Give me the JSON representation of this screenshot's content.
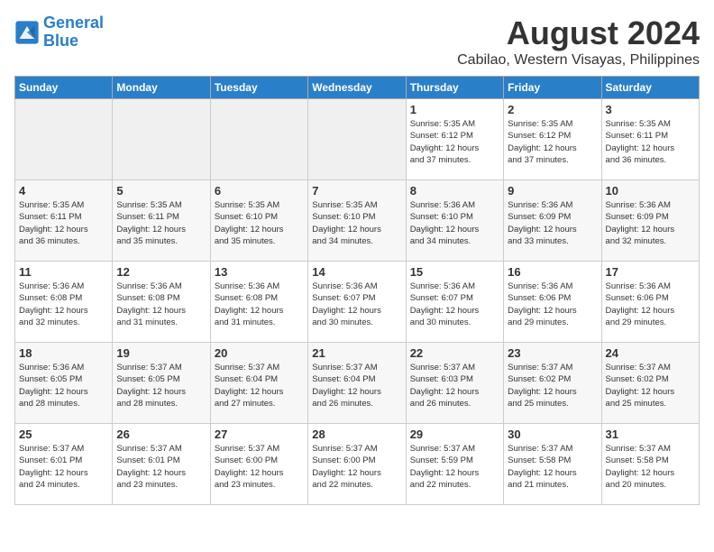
{
  "logo": {
    "line1": "General",
    "line2": "Blue"
  },
  "title": "August 2024",
  "subtitle": "Cabilao, Western Visayas, Philippines",
  "days_of_week": [
    "Sunday",
    "Monday",
    "Tuesday",
    "Wednesday",
    "Thursday",
    "Friday",
    "Saturday"
  ],
  "weeks": [
    [
      {
        "num": "",
        "info": "",
        "empty": true
      },
      {
        "num": "",
        "info": "",
        "empty": true
      },
      {
        "num": "",
        "info": "",
        "empty": true
      },
      {
        "num": "",
        "info": "",
        "empty": true
      },
      {
        "num": "1",
        "info": "Sunrise: 5:35 AM\nSunset: 6:12 PM\nDaylight: 12 hours\nand 37 minutes.",
        "empty": false
      },
      {
        "num": "2",
        "info": "Sunrise: 5:35 AM\nSunset: 6:12 PM\nDaylight: 12 hours\nand 37 minutes.",
        "empty": false
      },
      {
        "num": "3",
        "info": "Sunrise: 5:35 AM\nSunset: 6:11 PM\nDaylight: 12 hours\nand 36 minutes.",
        "empty": false
      }
    ],
    [
      {
        "num": "4",
        "info": "Sunrise: 5:35 AM\nSunset: 6:11 PM\nDaylight: 12 hours\nand 36 minutes.",
        "empty": false
      },
      {
        "num": "5",
        "info": "Sunrise: 5:35 AM\nSunset: 6:11 PM\nDaylight: 12 hours\nand 35 minutes.",
        "empty": false
      },
      {
        "num": "6",
        "info": "Sunrise: 5:35 AM\nSunset: 6:10 PM\nDaylight: 12 hours\nand 35 minutes.",
        "empty": false
      },
      {
        "num": "7",
        "info": "Sunrise: 5:35 AM\nSunset: 6:10 PM\nDaylight: 12 hours\nand 34 minutes.",
        "empty": false
      },
      {
        "num": "8",
        "info": "Sunrise: 5:36 AM\nSunset: 6:10 PM\nDaylight: 12 hours\nand 34 minutes.",
        "empty": false
      },
      {
        "num": "9",
        "info": "Sunrise: 5:36 AM\nSunset: 6:09 PM\nDaylight: 12 hours\nand 33 minutes.",
        "empty": false
      },
      {
        "num": "10",
        "info": "Sunrise: 5:36 AM\nSunset: 6:09 PM\nDaylight: 12 hours\nand 32 minutes.",
        "empty": false
      }
    ],
    [
      {
        "num": "11",
        "info": "Sunrise: 5:36 AM\nSunset: 6:08 PM\nDaylight: 12 hours\nand 32 minutes.",
        "empty": false
      },
      {
        "num": "12",
        "info": "Sunrise: 5:36 AM\nSunset: 6:08 PM\nDaylight: 12 hours\nand 31 minutes.",
        "empty": false
      },
      {
        "num": "13",
        "info": "Sunrise: 5:36 AM\nSunset: 6:08 PM\nDaylight: 12 hours\nand 31 minutes.",
        "empty": false
      },
      {
        "num": "14",
        "info": "Sunrise: 5:36 AM\nSunset: 6:07 PM\nDaylight: 12 hours\nand 30 minutes.",
        "empty": false
      },
      {
        "num": "15",
        "info": "Sunrise: 5:36 AM\nSunset: 6:07 PM\nDaylight: 12 hours\nand 30 minutes.",
        "empty": false
      },
      {
        "num": "16",
        "info": "Sunrise: 5:36 AM\nSunset: 6:06 PM\nDaylight: 12 hours\nand 29 minutes.",
        "empty": false
      },
      {
        "num": "17",
        "info": "Sunrise: 5:36 AM\nSunset: 6:06 PM\nDaylight: 12 hours\nand 29 minutes.",
        "empty": false
      }
    ],
    [
      {
        "num": "18",
        "info": "Sunrise: 5:36 AM\nSunset: 6:05 PM\nDaylight: 12 hours\nand 28 minutes.",
        "empty": false
      },
      {
        "num": "19",
        "info": "Sunrise: 5:37 AM\nSunset: 6:05 PM\nDaylight: 12 hours\nand 28 minutes.",
        "empty": false
      },
      {
        "num": "20",
        "info": "Sunrise: 5:37 AM\nSunset: 6:04 PM\nDaylight: 12 hours\nand 27 minutes.",
        "empty": false
      },
      {
        "num": "21",
        "info": "Sunrise: 5:37 AM\nSunset: 6:04 PM\nDaylight: 12 hours\nand 26 minutes.",
        "empty": false
      },
      {
        "num": "22",
        "info": "Sunrise: 5:37 AM\nSunset: 6:03 PM\nDaylight: 12 hours\nand 26 minutes.",
        "empty": false
      },
      {
        "num": "23",
        "info": "Sunrise: 5:37 AM\nSunset: 6:02 PM\nDaylight: 12 hours\nand 25 minutes.",
        "empty": false
      },
      {
        "num": "24",
        "info": "Sunrise: 5:37 AM\nSunset: 6:02 PM\nDaylight: 12 hours\nand 25 minutes.",
        "empty": false
      }
    ],
    [
      {
        "num": "25",
        "info": "Sunrise: 5:37 AM\nSunset: 6:01 PM\nDaylight: 12 hours\nand 24 minutes.",
        "empty": false
      },
      {
        "num": "26",
        "info": "Sunrise: 5:37 AM\nSunset: 6:01 PM\nDaylight: 12 hours\nand 23 minutes.",
        "empty": false
      },
      {
        "num": "27",
        "info": "Sunrise: 5:37 AM\nSunset: 6:00 PM\nDaylight: 12 hours\nand 23 minutes.",
        "empty": false
      },
      {
        "num": "28",
        "info": "Sunrise: 5:37 AM\nSunset: 6:00 PM\nDaylight: 12 hours\nand 22 minutes.",
        "empty": false
      },
      {
        "num": "29",
        "info": "Sunrise: 5:37 AM\nSunset: 5:59 PM\nDaylight: 12 hours\nand 22 minutes.",
        "empty": false
      },
      {
        "num": "30",
        "info": "Sunrise: 5:37 AM\nSunset: 5:58 PM\nDaylight: 12 hours\nand 21 minutes.",
        "empty": false
      },
      {
        "num": "31",
        "info": "Sunrise: 5:37 AM\nSunset: 5:58 PM\nDaylight: 12 hours\nand 20 minutes.",
        "empty": false
      }
    ]
  ]
}
